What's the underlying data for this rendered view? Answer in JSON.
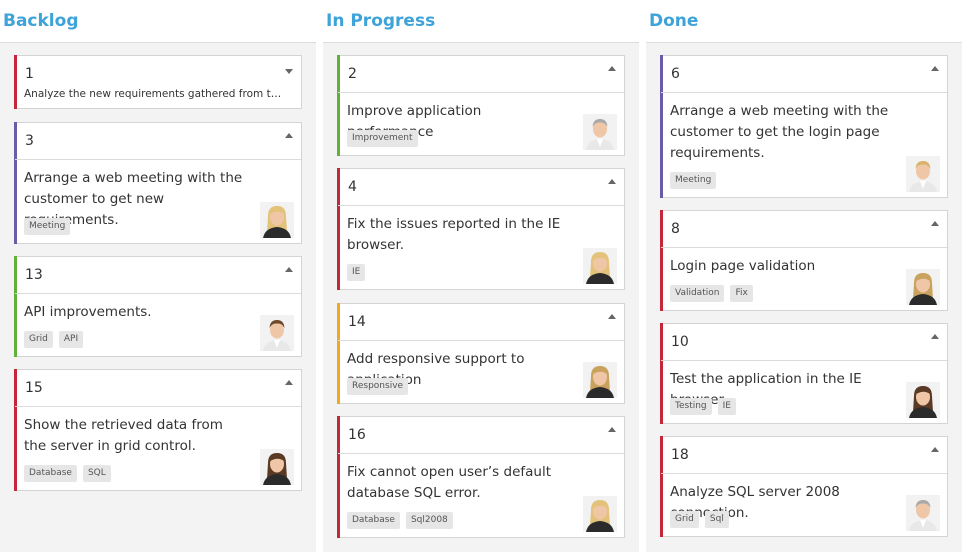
{
  "colors": {
    "accent": "#3ea3d8",
    "red": "#c6263a",
    "purple": "#6b5aa6",
    "green": "#5fb13a",
    "orange": "#f0a820"
  },
  "columns": [
    {
      "title": "Backlog",
      "cards": [
        {
          "id": "1",
          "summary": "Analyze the new requirements gathered from th...",
          "tags": [],
          "collapsed": true,
          "priority_color": "red",
          "avatar": "none"
        },
        {
          "id": "3",
          "summary": "Arrange a web meeting with the customer to get new requirements.",
          "tags": [
            "Meeting"
          ],
          "collapsed": false,
          "priority_color": "purple",
          "avatar": "woman-blonde-avatar"
        },
        {
          "id": "13",
          "summary": "API improvements.",
          "tags": [
            "Grid",
            "API"
          ],
          "collapsed": false,
          "priority_color": "green",
          "avatar": "man-brown-hair-avatar"
        },
        {
          "id": "15",
          "summary": "Show the retrieved data from the server in grid control.",
          "tags": [
            "Database",
            "SQL"
          ],
          "collapsed": false,
          "priority_color": "red",
          "avatar": "woman-short-hair-avatar"
        }
      ]
    },
    {
      "title": "In Progress",
      "cards": [
        {
          "id": "2",
          "summary": "Improve application performance",
          "tags": [
            "Improvement"
          ],
          "collapsed": false,
          "priority_color": "green",
          "avatar": "man-gray-hair-avatar"
        },
        {
          "id": "4",
          "summary": "Fix the issues reported in the IE browser.",
          "tags": [
            "IE"
          ],
          "collapsed": false,
          "priority_color": "red",
          "avatar": "woman-blonde-avatar"
        },
        {
          "id": "14",
          "summary": "Add responsive support to application",
          "tags": [
            "Responsive"
          ],
          "collapsed": false,
          "priority_color": "orange",
          "avatar": "woman-curly-hair-avatar"
        },
        {
          "id": "16",
          "summary": "Fix cannot open user’s default database SQL error.",
          "tags": [
            "Database",
            "Sql2008"
          ],
          "collapsed": false,
          "priority_color": "red",
          "avatar": "woman-blonde-avatar"
        }
      ]
    },
    {
      "title": "Done",
      "cards": [
        {
          "id": "6",
          "summary": "Arrange a web meeting with the customer to get the login page requirements.",
          "tags": [
            "Meeting"
          ],
          "collapsed": false,
          "priority_color": "purple",
          "avatar": "man-blonde-avatar"
        },
        {
          "id": "8",
          "summary": "Login page validation",
          "tags": [
            "Validation",
            "Fix"
          ],
          "collapsed": false,
          "priority_color": "red",
          "avatar": "woman-curly-hair-avatar"
        },
        {
          "id": "10",
          "summary": "Test the application in the IE browser.",
          "tags": [
            "Testing",
            "IE"
          ],
          "collapsed": false,
          "priority_color": "red",
          "avatar": "woman-short-hair-avatar"
        },
        {
          "id": "18",
          "summary": "Analyze SQL server 2008 connection.",
          "tags": [
            "Grid",
            "Sql"
          ],
          "collapsed": false,
          "priority_color": "red",
          "avatar": "man-gray-hair-avatar"
        }
      ]
    }
  ]
}
